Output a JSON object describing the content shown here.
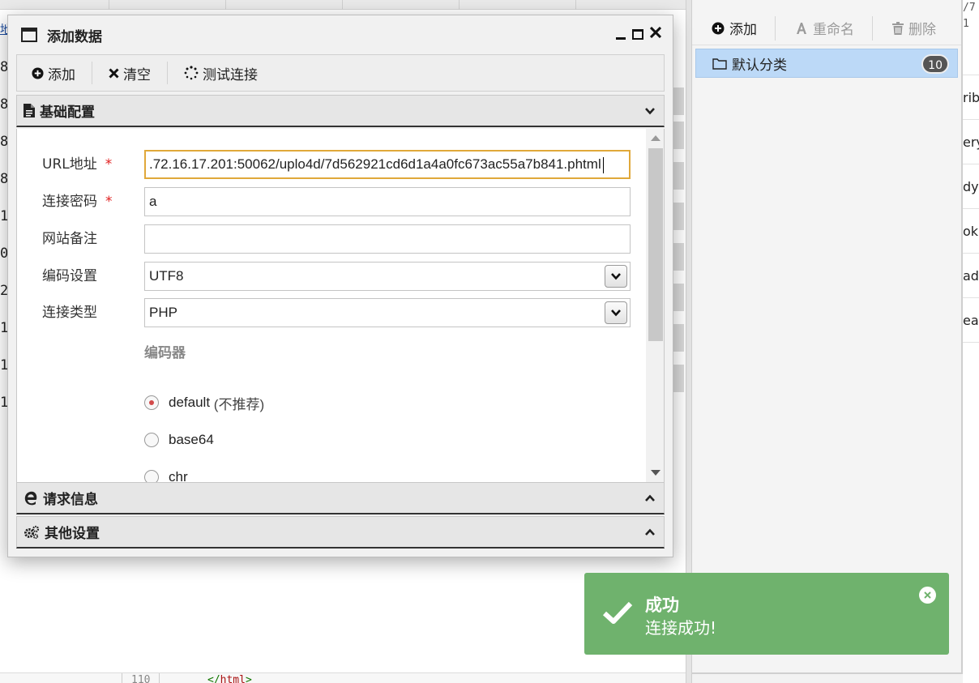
{
  "background": {
    "gutter_digits": [
      "8",
      "8",
      "8",
      "8",
      "1",
      "0",
      "2",
      "1",
      "1",
      "1"
    ],
    "address_fragment": "地",
    "code_line_number": "110",
    "code_closing_tag": "html",
    "far_right_top": [
      "/7",
      "1"
    ],
    "far_right_rows": [
      "rib",
      "ery",
      "dy",
      "oki",
      "ade",
      "ea"
    ]
  },
  "category_panel": {
    "toolbar": {
      "add_label": "添加",
      "rename_label": "重命名",
      "delete_label": "删除"
    },
    "items": [
      {
        "label": "默认分类",
        "count": "10",
        "icon": "folder-icon"
      }
    ]
  },
  "dialog": {
    "title": "添加数据",
    "toolbar": {
      "add_label": "添加",
      "clear_label": "清空",
      "test_label": "测试连接"
    },
    "sections": {
      "basic": "基础配置",
      "request": "请求信息",
      "other": "其他设置"
    },
    "form": {
      "url_label": "URL地址",
      "url_value": ".72.16.17.201:50062/uplo4d/7d562921cd6d1a4a0fc673ac55a7b841.phtml",
      "password_label": "连接密码",
      "password_value": "a",
      "note_label": "网站备注",
      "note_value": "",
      "encoding_label": "编码设置",
      "encoding_value": "UTF8",
      "type_label": "连接类型",
      "type_value": "PHP",
      "required_mark": "*",
      "encoder_title": "编码器",
      "encoders": [
        {
          "name": "default",
          "note": "(不推荐)",
          "checked": true
        },
        {
          "name": "base64",
          "note": "",
          "checked": false
        },
        {
          "name": "chr",
          "note": "",
          "checked": false
        }
      ]
    }
  },
  "toast": {
    "title": "成功",
    "message": "连接成功!",
    "color": "#6fb26d"
  }
}
